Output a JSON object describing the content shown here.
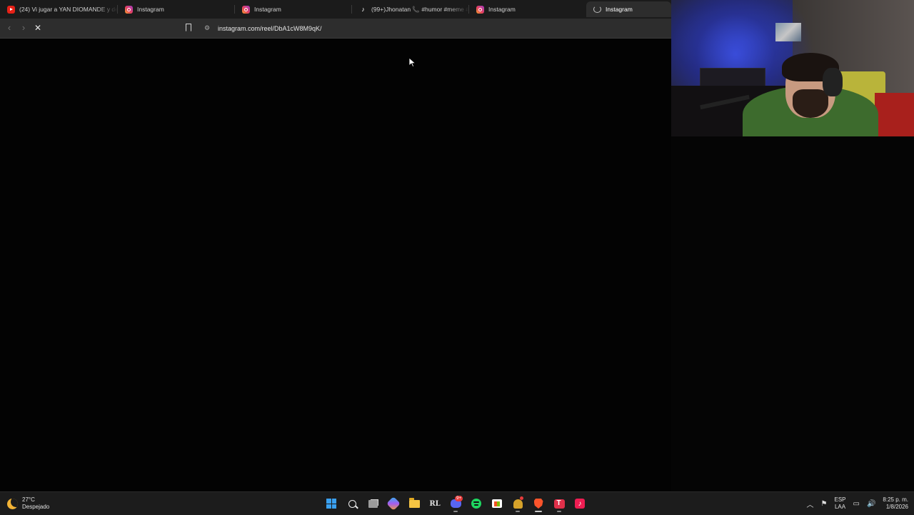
{
  "browser": {
    "tabs": [
      {
        "label": "(24) Vi jugar a YAN DIOMANDE y de",
        "favicon": "youtube-icon",
        "active": false
      },
      {
        "label": "Instagram",
        "favicon": "instagram-icon",
        "active": false
      },
      {
        "label": "Instagram",
        "favicon": "instagram-icon",
        "active": false
      },
      {
        "label": "(99+)Jhonatan 📞 #humor #meme #",
        "favicon": "tiktok-icon",
        "active": false
      },
      {
        "label": "Instagram",
        "favicon": "instagram-icon",
        "active": false
      },
      {
        "label": "Instagram",
        "favicon": "loading-icon",
        "active": true
      }
    ],
    "url": "instagram.com/reel/DbA1cW8M9qK/"
  },
  "taskbar": {
    "weather": {
      "temp": "27°C",
      "condition": "Despejado"
    },
    "apps": [
      "windows-start-icon",
      "search-icon",
      "task-view-icon",
      "copilot-icon",
      "file-explorer-icon",
      "rl-app-icon",
      "discord-icon",
      "spotify-icon",
      "microsoft-store-icon",
      "game-app-icon",
      "brave-icon",
      "red-app-icon",
      "tiktok-icon"
    ],
    "discord_badge": "9+",
    "tray": {
      "lang_line1": "ESP",
      "lang_line2": "LAA",
      "time": "8:25 p. m.",
      "date": "1/8/2026"
    }
  },
  "colors": {
    "tab_bar": "#1b1b1b",
    "toolbar": "#2d2d2d",
    "page_bg": "#030303",
    "taskbar": "#1c1c1c"
  }
}
